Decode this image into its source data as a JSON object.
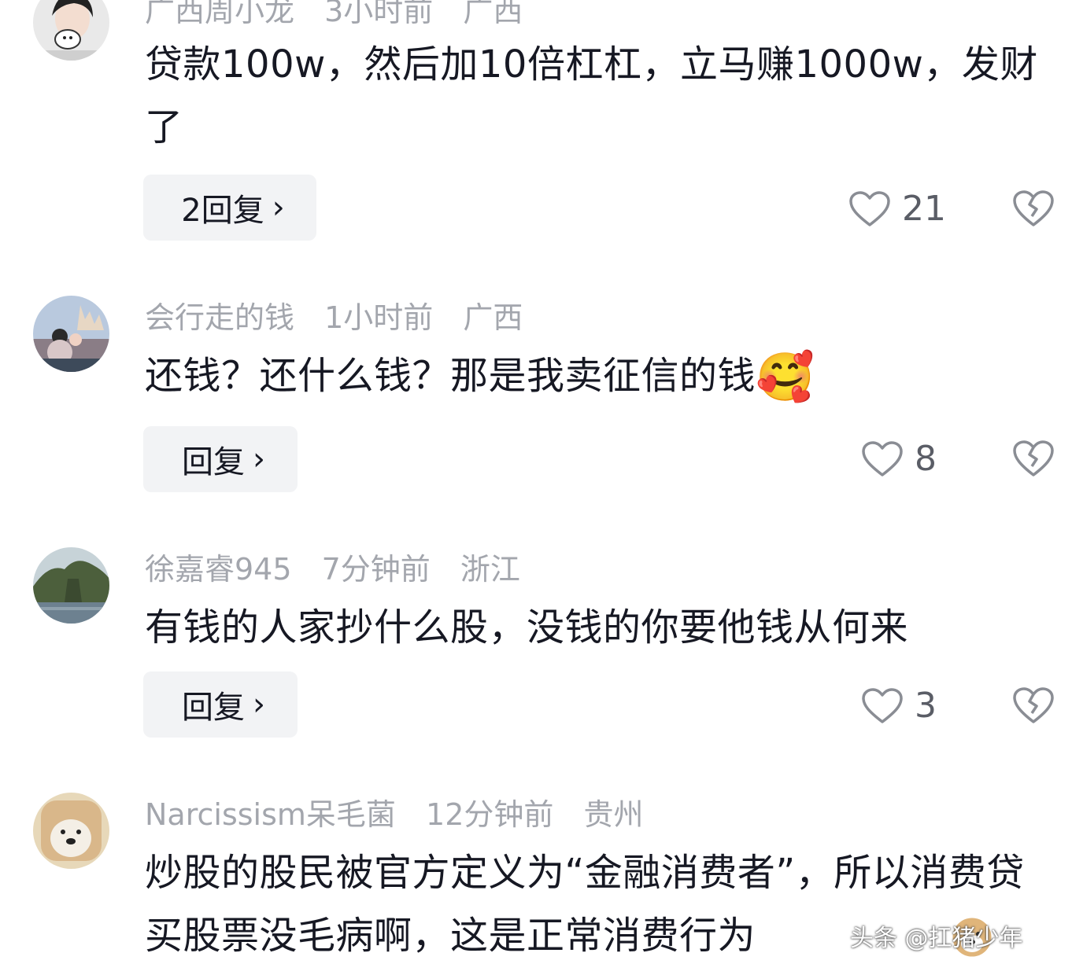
{
  "comments": [
    {
      "username": "广西周小龙",
      "time": "3小时前",
      "location": "广西",
      "text": "贷款100w，然后加10倍杠杠，立马赚1000w，发财了",
      "reply_label": "2回复",
      "likes": "21"
    },
    {
      "username": "会行走的钱",
      "time": "1小时前",
      "location": "广西",
      "text": "还钱？还什么钱？那是我卖征信的钱",
      "emoji": "🥰",
      "reply_label": "回复",
      "likes": "8"
    },
    {
      "username": "徐嘉睿945",
      "time": "7分钟前",
      "location": "浙江",
      "text": "有钱的人家抄什么股，没钱的你要他钱从何来",
      "reply_label": "回复",
      "likes": "3"
    },
    {
      "username": "Narcissism呆毛菌",
      "time": "12分钟前",
      "location": "贵州",
      "text": "炒股的股民被官方定义为“金融消费者”，所以消费贷买股票没毛病啊，这是正常消费行为"
    }
  ],
  "watermark": "头条 @扛猪少年",
  "icons": {
    "like": "heart-outline-icon",
    "dislike": "broken-heart-icon",
    "reply_chevron": "chevron-right-icon"
  },
  "colors": {
    "text": "#161823",
    "meta": "#a3a6ad",
    "button_bg": "#f2f3f5",
    "count": "#5a5d66"
  }
}
